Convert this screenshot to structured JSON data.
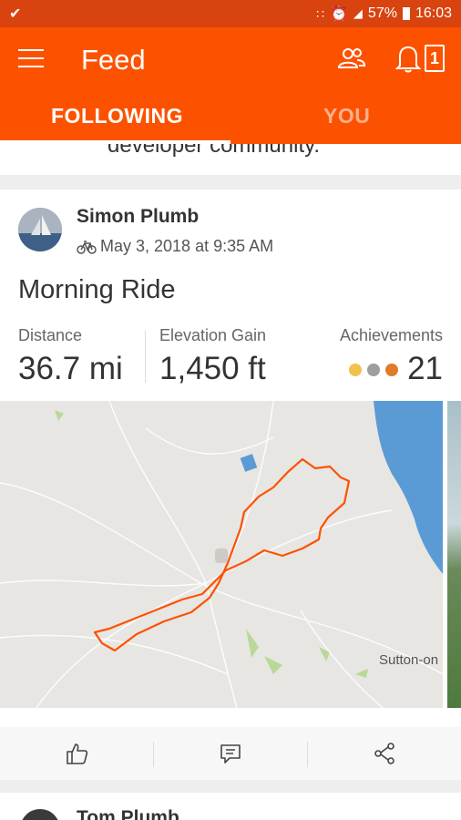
{
  "status_bar": {
    "battery": "57%",
    "time": "16:03"
  },
  "header": {
    "title": "Feed",
    "notification_count": "1",
    "tabs": [
      {
        "label": "FOLLOWING"
      },
      {
        "label": "YOU"
      }
    ]
  },
  "previous_card": {
    "partial_text": "developer community."
  },
  "activity": {
    "athlete_name": "Simon Plumb",
    "date": "May 3, 2018 at 9:35 AM",
    "title": "Morning Ride",
    "stats": [
      {
        "label": "Distance",
        "value": "36.7 mi"
      },
      {
        "label": "Elevation Gain",
        "value": "1,450 ft"
      }
    ],
    "achievements": {
      "label": "Achievements",
      "value": "21",
      "medal_colors": [
        "#f2c14e",
        "#9e9e9e",
        "#e07b2a"
      ]
    },
    "map": {
      "place_label": "Sutton-on"
    },
    "actions": [
      {
        "icon": "thumbs-up-icon"
      },
      {
        "icon": "comment-icon"
      },
      {
        "icon": "share-icon"
      }
    ]
  },
  "next_card": {
    "athlete_name": "Tom Plumb"
  },
  "colors": {
    "brand": "#fc5200",
    "status_bar": "#d8430f",
    "route": "#fc5200"
  }
}
